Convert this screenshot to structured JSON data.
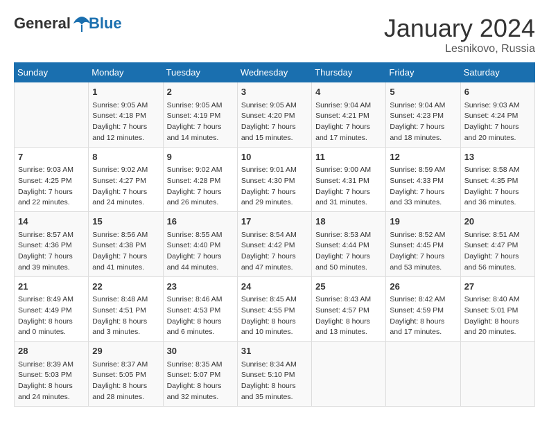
{
  "header": {
    "logo_general": "General",
    "logo_blue": "Blue",
    "month_title": "January 2024",
    "location": "Lesnikovo, Russia"
  },
  "weekdays": [
    "Sunday",
    "Monday",
    "Tuesday",
    "Wednesday",
    "Thursday",
    "Friday",
    "Saturday"
  ],
  "weeks": [
    [
      {
        "day": "",
        "content": ""
      },
      {
        "day": "1",
        "content": "Sunrise: 9:05 AM\nSunset: 4:18 PM\nDaylight: 7 hours\nand 12 minutes."
      },
      {
        "day": "2",
        "content": "Sunrise: 9:05 AM\nSunset: 4:19 PM\nDaylight: 7 hours\nand 14 minutes."
      },
      {
        "day": "3",
        "content": "Sunrise: 9:05 AM\nSunset: 4:20 PM\nDaylight: 7 hours\nand 15 minutes."
      },
      {
        "day": "4",
        "content": "Sunrise: 9:04 AM\nSunset: 4:21 PM\nDaylight: 7 hours\nand 17 minutes."
      },
      {
        "day": "5",
        "content": "Sunrise: 9:04 AM\nSunset: 4:23 PM\nDaylight: 7 hours\nand 18 minutes."
      },
      {
        "day": "6",
        "content": "Sunrise: 9:03 AM\nSunset: 4:24 PM\nDaylight: 7 hours\nand 20 minutes."
      }
    ],
    [
      {
        "day": "7",
        "content": "Sunrise: 9:03 AM\nSunset: 4:25 PM\nDaylight: 7 hours\nand 22 minutes."
      },
      {
        "day": "8",
        "content": "Sunrise: 9:02 AM\nSunset: 4:27 PM\nDaylight: 7 hours\nand 24 minutes."
      },
      {
        "day": "9",
        "content": "Sunrise: 9:02 AM\nSunset: 4:28 PM\nDaylight: 7 hours\nand 26 minutes."
      },
      {
        "day": "10",
        "content": "Sunrise: 9:01 AM\nSunset: 4:30 PM\nDaylight: 7 hours\nand 29 minutes."
      },
      {
        "day": "11",
        "content": "Sunrise: 9:00 AM\nSunset: 4:31 PM\nDaylight: 7 hours\nand 31 minutes."
      },
      {
        "day": "12",
        "content": "Sunrise: 8:59 AM\nSunset: 4:33 PM\nDaylight: 7 hours\nand 33 minutes."
      },
      {
        "day": "13",
        "content": "Sunrise: 8:58 AM\nSunset: 4:35 PM\nDaylight: 7 hours\nand 36 minutes."
      }
    ],
    [
      {
        "day": "14",
        "content": "Sunrise: 8:57 AM\nSunset: 4:36 PM\nDaylight: 7 hours\nand 39 minutes."
      },
      {
        "day": "15",
        "content": "Sunrise: 8:56 AM\nSunset: 4:38 PM\nDaylight: 7 hours\nand 41 minutes."
      },
      {
        "day": "16",
        "content": "Sunrise: 8:55 AM\nSunset: 4:40 PM\nDaylight: 7 hours\nand 44 minutes."
      },
      {
        "day": "17",
        "content": "Sunrise: 8:54 AM\nSunset: 4:42 PM\nDaylight: 7 hours\nand 47 minutes."
      },
      {
        "day": "18",
        "content": "Sunrise: 8:53 AM\nSunset: 4:44 PM\nDaylight: 7 hours\nand 50 minutes."
      },
      {
        "day": "19",
        "content": "Sunrise: 8:52 AM\nSunset: 4:45 PM\nDaylight: 7 hours\nand 53 minutes."
      },
      {
        "day": "20",
        "content": "Sunrise: 8:51 AM\nSunset: 4:47 PM\nDaylight: 7 hours\nand 56 minutes."
      }
    ],
    [
      {
        "day": "21",
        "content": "Sunrise: 8:49 AM\nSunset: 4:49 PM\nDaylight: 8 hours\nand 0 minutes."
      },
      {
        "day": "22",
        "content": "Sunrise: 8:48 AM\nSunset: 4:51 PM\nDaylight: 8 hours\nand 3 minutes."
      },
      {
        "day": "23",
        "content": "Sunrise: 8:46 AM\nSunset: 4:53 PM\nDaylight: 8 hours\nand 6 minutes."
      },
      {
        "day": "24",
        "content": "Sunrise: 8:45 AM\nSunset: 4:55 PM\nDaylight: 8 hours\nand 10 minutes."
      },
      {
        "day": "25",
        "content": "Sunrise: 8:43 AM\nSunset: 4:57 PM\nDaylight: 8 hours\nand 13 minutes."
      },
      {
        "day": "26",
        "content": "Sunrise: 8:42 AM\nSunset: 4:59 PM\nDaylight: 8 hours\nand 17 minutes."
      },
      {
        "day": "27",
        "content": "Sunrise: 8:40 AM\nSunset: 5:01 PM\nDaylight: 8 hours\nand 20 minutes."
      }
    ],
    [
      {
        "day": "28",
        "content": "Sunrise: 8:39 AM\nSunset: 5:03 PM\nDaylight: 8 hours\nand 24 minutes."
      },
      {
        "day": "29",
        "content": "Sunrise: 8:37 AM\nSunset: 5:05 PM\nDaylight: 8 hours\nand 28 minutes."
      },
      {
        "day": "30",
        "content": "Sunrise: 8:35 AM\nSunset: 5:07 PM\nDaylight: 8 hours\nand 32 minutes."
      },
      {
        "day": "31",
        "content": "Sunrise: 8:34 AM\nSunset: 5:10 PM\nDaylight: 8 hours\nand 35 minutes."
      },
      {
        "day": "",
        "content": ""
      },
      {
        "day": "",
        "content": ""
      },
      {
        "day": "",
        "content": ""
      }
    ]
  ]
}
